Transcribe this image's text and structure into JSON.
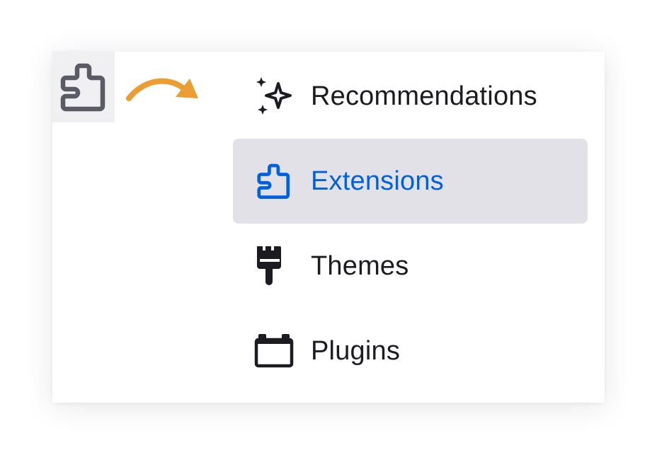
{
  "colors": {
    "selected_bg": "#e2e1e7",
    "selected_text": "#0061e0",
    "text": "#1c1b22",
    "arrow": "#eb9c32",
    "toolbar_icon": "#5b5b66"
  },
  "toolbar": {
    "extensions_button_icon": "puzzle-piece-icon"
  },
  "menu": {
    "items": [
      {
        "id": "recommendations",
        "label": "Recommendations",
        "icon": "sparkles-icon",
        "selected": false
      },
      {
        "id": "extensions",
        "label": "Extensions",
        "icon": "puzzle-piece-icon",
        "selected": true
      },
      {
        "id": "themes",
        "label": "Themes",
        "icon": "paintbrush-icon",
        "selected": false
      },
      {
        "id": "plugins",
        "label": "Plugins",
        "icon": "plugin-block-icon",
        "selected": false
      }
    ]
  }
}
